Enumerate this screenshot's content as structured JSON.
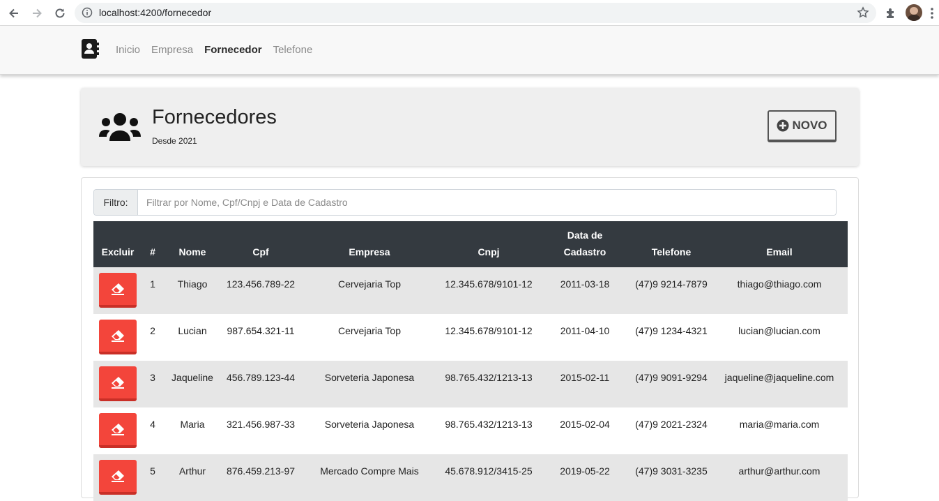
{
  "browser": {
    "url": "localhost:4200/fornecedor"
  },
  "navbar": {
    "brand_icon": "address-book-icon",
    "links": [
      {
        "label": "Inicio",
        "active": false
      },
      {
        "label": "Empresa",
        "active": false
      },
      {
        "label": "Fornecedor",
        "active": true
      },
      {
        "label": "Telefone",
        "active": false
      }
    ]
  },
  "header": {
    "icon": "users-icon",
    "title": "Fornecedores",
    "subtitle": "Desde 2021",
    "new_button": "NOVO"
  },
  "filter": {
    "label": "Filtro:",
    "placeholder": "Filtrar por Nome, Cpf/Cnpj e Data de Cadastro",
    "value": ""
  },
  "table": {
    "headers": {
      "excluir": "Excluir",
      "num": "#",
      "nome": "Nome",
      "cpf": "Cpf",
      "empresa": "Empresa",
      "cnpj": "Cnpj",
      "data_line1": "Data de",
      "data_line2": "Cadastro",
      "telefone": "Telefone",
      "email": "Email"
    },
    "rows": [
      {
        "num": "1",
        "nome": "Thiago",
        "cpf": "123.456.789-22",
        "empresa": "Cervejaria Top",
        "cnpj": "12.345.678/9101-12",
        "data": "2011-03-18",
        "telefone": "(47)9 9214-7879",
        "email": "thiago@thiago.com"
      },
      {
        "num": "2",
        "nome": "Lucian",
        "cpf": "987.654.321-11",
        "empresa": "Cervejaria Top",
        "cnpj": "12.345.678/9101-12",
        "data": "2011-04-10",
        "telefone": "(47)9 1234-4321",
        "email": "lucian@lucian.com"
      },
      {
        "num": "3",
        "nome": "Jaqueline",
        "cpf": "456.789.123-44",
        "empresa": "Sorveteria Japonesa",
        "cnpj": "98.765.432/1213-13",
        "data": "2015-02-11",
        "telefone": "(47)9 9091-9294",
        "email": "jaqueline@jaqueline.com"
      },
      {
        "num": "4",
        "nome": "Maria",
        "cpf": "321.456.987-33",
        "empresa": "Sorveteria Japonesa",
        "cnpj": "98.765.432/1213-13",
        "data": "2015-02-04",
        "telefone": "(47)9 2021-2324",
        "email": "maria@maria.com"
      },
      {
        "num": "5",
        "nome": "Arthur",
        "cpf": "876.459.213-97",
        "empresa": "Mercado Compre Mais",
        "cnpj": "45.678.912/3415-25",
        "data": "2019-05-22",
        "telefone": "(47)9 3031-3235",
        "email": "arthur@arthur.com"
      }
    ]
  },
  "colors": {
    "delete_button": "#f3453b",
    "table_header": "#343a40",
    "stripe": "#e6e6e6"
  }
}
